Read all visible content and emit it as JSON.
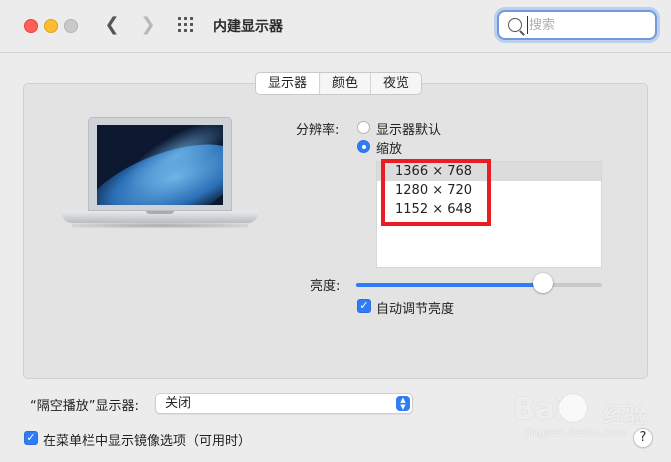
{
  "window": {
    "title": "内建显示器",
    "search": {
      "value": "",
      "placeholder": "搜索"
    }
  },
  "tabs": [
    {
      "label": "显示器",
      "selected": true
    },
    {
      "label": "颜色",
      "selected": false
    },
    {
      "label": "夜览",
      "selected": false
    }
  ],
  "display": {
    "resolution_label": "分辨率:",
    "options": [
      {
        "label": "显示器默认",
        "selected": false
      },
      {
        "label": "缩放",
        "selected": true
      }
    ],
    "scaled_resolutions": [
      {
        "label": "1366 × 768",
        "selected": true
      },
      {
        "label": "1280 × 720",
        "selected": false
      },
      {
        "label": "1152 × 648",
        "selected": false
      }
    ],
    "brightness_label": "亮度:",
    "brightness_level": 0.76,
    "auto_brightness_label": "自动调节亮度",
    "auto_brightness_checked": true
  },
  "airplay": {
    "label": "“隔空播放”显示器:",
    "selected": "关闭"
  },
  "mirroring": {
    "label": "在菜单栏中显示镜像选项（可用时）",
    "checked": true
  },
  "help_label": "?",
  "watermark": {
    "logo": "Bai",
    "brand": "经验",
    "site": "jingyan.baidu.com"
  },
  "colors": {
    "accent": "#2f7cf6",
    "annotation_box": "#ea1e22"
  }
}
